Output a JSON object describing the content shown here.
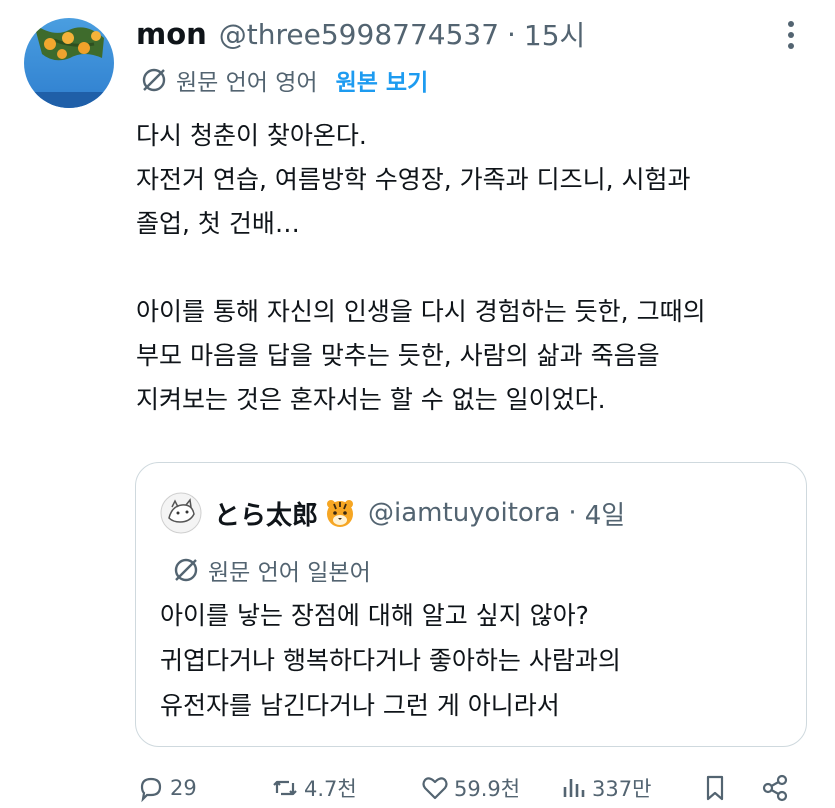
{
  "tweet": {
    "author_name": "mon",
    "handle": "@three5998774537",
    "separator": "·",
    "time": "15시",
    "translation": {
      "label": "원문 언어 영어",
      "show_original": "원본 보기"
    },
    "text": "다시 청춘이 찾아온다.\n자전거 연습, 여름방학 수영장, 가족과 디즈니, 시험과\n졸업, 첫 건배…\n\n아이를 통해 자신의 인생을 다시 경험하는 듯한, 그때의\n부모 마음을 답을 맞추는 듯한, 사람의 삶과 죽음을\n지켜보는 것은 혼자서는 할 수 없는 일이었다."
  },
  "quote": {
    "author_name": "とら太郎",
    "emoji_icon": "tiger-face-icon",
    "handle": "@iamtuyoitora",
    "separator": "·",
    "time": "4일",
    "translation_label": "원문 언어 일본어",
    "text": "아이를 낳는 장점에 대해 알고 싶지 않아?\n귀엽다거나 행복하다거나 좋아하는 사람과의\n유전자를 남긴다거나 그런 게 아니라서"
  },
  "actions": {
    "replies": "29",
    "retweets": "4.7천",
    "likes": "59.9천",
    "views": "337만"
  },
  "colors": {
    "text": "#0f1419",
    "secondary": "#536471",
    "accent": "#1d9bf0",
    "border": "#cfd9de"
  }
}
